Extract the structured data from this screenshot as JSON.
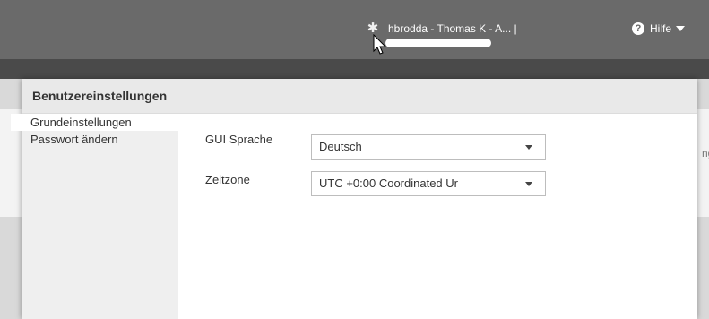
{
  "topbar": {
    "user_label": "hbrodda - Thomas K - A... |",
    "help_label": "Hilfe",
    "icons": {
      "user": "gear-icon",
      "help": "question-circle-icon",
      "help_dropdown": "caret-down-icon"
    }
  },
  "background": {
    "partial_text": "ng"
  },
  "dialog": {
    "title": "Benutzereinstellungen",
    "nav": [
      {
        "label": "Grundeinstellungen",
        "active": true
      },
      {
        "label": "Passwort ändern",
        "active": false
      }
    ],
    "form": {
      "gui_language": {
        "label": "GUI Sprache",
        "value": "Deutsch"
      },
      "timezone": {
        "label": "Zeitzone",
        "value": "UTC +0:00 Coordinated Ur"
      }
    }
  }
}
